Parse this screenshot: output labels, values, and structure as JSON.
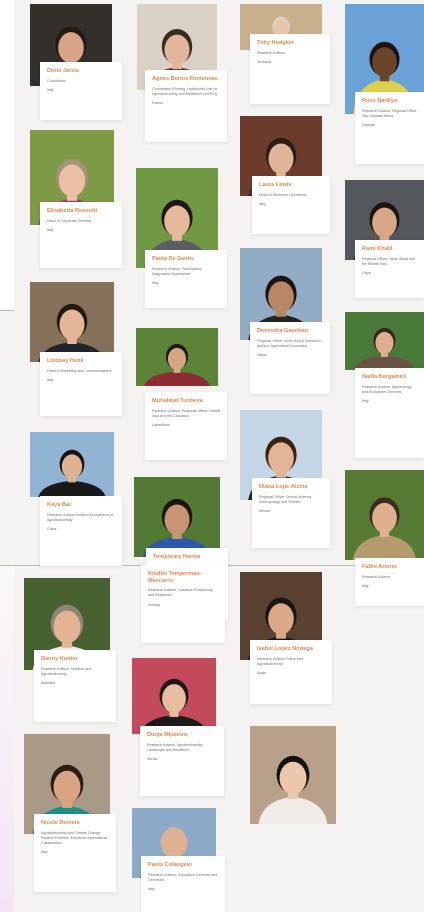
{
  "people": [
    {
      "id": "doris-jarvis",
      "name": "Doris Jarvis",
      "role": "Coordinator",
      "country": "Italy",
      "photo": {
        "bg": "#33302c",
        "skin": "#d8a486",
        "hair": "#241a14",
        "shirt": "#3c3834"
      }
    },
    {
      "id": "agnes-bernis",
      "name": "Agnes Bernis Fonteneau",
      "role": "Coordinator (Poverty, Livelihoods Unit for Agrobiodiversity and Resilience (AGRD))",
      "country": "France",
      "photo": {
        "bg": "#d9d1c5",
        "skin": "#e2b69a",
        "hair": "#3a2a1f",
        "shirt": "#7e2426"
      }
    },
    {
      "id": "toby-hodgkin",
      "name": "Toby Hodgkin",
      "role": "Research Advisor",
      "country": "Scotland",
      "photo": {
        "bg": "#c9b08a",
        "skin": "#e8c6ac",
        "hair": "#d9d2c7",
        "shirt": "#aab3c0"
      }
    },
    {
      "id": "ross-nankya",
      "name": "Ross Nankya",
      "role": "Research Advisor, Regional Office Sub-Saharan Africa",
      "country": "Uganda",
      "photo": {
        "bg": "#6aa2d8",
        "skin": "#6b4429",
        "hair": "#1c130e",
        "shirt": "#ddd04a"
      }
    },
    {
      "id": "laura-lewis",
      "name": "Laura Lewis",
      "role": "Head of Research Operations",
      "country": "Italy",
      "photo": {
        "bg": "#6d3b2c",
        "skin": "#e0b497",
        "hair": "#2a1d16",
        "shirt": "#3a3634"
      }
    },
    {
      "id": "elisabetta-rossetti",
      "name": "Elisabetta Rossetti",
      "role": "Head of Corporate Services",
      "country": "Italy",
      "photo": {
        "bg": "#7d9a46",
        "skin": "#ebc0a6",
        "hair": "#a49378",
        "shirt": "#a03c7c"
      }
    },
    {
      "id": "paola-de-santis",
      "name": "Paola De Santis",
      "role": "Research Advisor, Participatory Diagnostics Approaches",
      "country": "Italy",
      "photo": {
        "bg": "#6f9a43",
        "skin": "#e6b99a",
        "hair": "#1e1814",
        "shirt": "#5a5e64"
      }
    },
    {
      "id": "rami-khalil",
      "name": "Rami Khalil",
      "role": "Regional Officer, Near/ Africa and the Middle East",
      "country": "Libya",
      "photo": {
        "bg": "#54585d",
        "skin": "#d6a785",
        "hair": "#1c1612",
        "shirt": "#3a3c40"
      }
    },
    {
      "id": "devendra-gauchan",
      "name": "Devendra Gauchan",
      "role": "Regional Officer South Asia & Research Advisor, Agricultural Economics",
      "country": "Nepal",
      "photo": {
        "bg": "#93acc6",
        "skin": "#b98764",
        "hair": "#1c1410",
        "shirt": "#262422"
      }
    },
    {
      "id": "nadia-bergamini",
      "name": "Nadia Bergamini",
      "role": "Research Advisor, Agroecology and Ecosystem Services",
      "country": "Italy",
      "photo": {
        "bg": "#4a7a3a",
        "skin": "#dcae92",
        "hair": "#3c2414",
        "shirt": "#6a5344"
      }
    },
    {
      "id": "lindsay-hook",
      "name": "Lindsay Hook",
      "role": "Head of Marketing and Communications",
      "country": "Italy",
      "photo": {
        "bg": "#85705a",
        "skin": "#e2b696",
        "hair": "#22180f",
        "shirt": "#20252d"
      }
    },
    {
      "id": "muhabbat-turdieva",
      "name": "Muhabbat Turdieva",
      "role": "Research Advisor, Regional Officer Central Asia and the Caucasus",
      "country": "Uzbekistan",
      "photo": {
        "bg": "#5c8436",
        "skin": "#d6a684",
        "hair": "#221812",
        "shirt": "#8e2c36"
      }
    },
    {
      "id": "diana-lope-alzina",
      "name": "Diana Lope-Alzina",
      "role": "Regional Officer Central America, Anthropology and Gender",
      "country": "Mexico",
      "photo": {
        "bg": "#c4d6e6",
        "skin": "#e3b496",
        "hair": "#3a2212",
        "shirt": "#1c2834"
      }
    },
    {
      "id": "kaya-bai",
      "name": "Kaya Bai",
      "role": "Research Advisor Nutrient Ecosystems of Agrobiodiversity",
      "country": "China",
      "photo": {
        "bg": "#8fb4d4",
        "skin": "#e0b294",
        "hair": "#19120c",
        "shirt": "#181818"
      }
    },
    {
      "id": "fabio-attorre",
      "name": "Fabio Attorre",
      "role": "Research Advisor",
      "country": "Italy",
      "photo": {
        "bg": "#577a34",
        "skin": "#deb08e",
        "hair": "#3b2c1f",
        "shirt": "#b49a6c"
      }
    },
    {
      "id": "danny-hunter",
      "name": "Danny Hunter",
      "role": "Research Advisor, Nutrition and Agrobiodiversity",
      "country": "Australia",
      "photo": {
        "bg": "#466030",
        "skin": "#e2b494",
        "hair": "#8e8476",
        "shirt": "#efefef"
      }
    },
    {
      "id": "alejandro-temporary",
      "name": "Temporary Hanna",
      "role": "Research Advisor, Linked to Production Functions",
      "country": "Germany",
      "photo": {
        "bg": "#527a34",
        "skin": "#c79474",
        "hair": "#1c1410",
        "shirt": "#2c5aa8"
      }
    },
    {
      "id": "kindlin-temperman",
      "name": "Kindlin Temperman-Meccarro",
      "role": "Research Advisor, Livestock Productivity and Resilience",
      "country": "Norway",
      "photo": null
    },
    {
      "id": "isabel-lopez-noriega",
      "name": "Isabel Lopez Noriega",
      "role": "Research Advisor Policy and Agrobiodiversity",
      "country": "Spain",
      "photo": {
        "bg": "#5a4030",
        "skin": "#d9a988",
        "hair": "#1c1410",
        "shirt": "#1a1a1a"
      }
    },
    {
      "id": "dunja-mijatovic",
      "name": "Dunja Mijatovic",
      "role": "Research Advisor, Agrobiodiversity, Landscape and Resilience",
      "country": "Serbia",
      "photo": {
        "bg": "#c24a5a",
        "skin": "#e8bc9e",
        "hair": "#1e1814",
        "shirt": "#1c1c1c"
      }
    },
    {
      "id": "nicole-demers",
      "name": "Nicole Demers",
      "role": "Agrobiodiversity and Climate Change; Relation Partners, Electronic International Collaboration",
      "country": "Italy",
      "photo": {
        "bg": "#a89a86",
        "skin": "#d8a482",
        "hair": "#2c1c12",
        "shirt": "#1c8e86"
      }
    },
    {
      "id": "paolo-colangelo",
      "name": "Paolo Colangelo",
      "role": "Research Advisor, Population Genetics and Genomics",
      "country": "Italy",
      "photo": {
        "bg": "#8aaac8",
        "skin": "#e0b092",
        "hair": "#e0b092",
        "shirt": "#2a2a2a"
      }
    },
    {
      "id": "new-photo",
      "name": "",
      "role": "",
      "country": "",
      "photo": {
        "bg": "#b8a18a",
        "skin": "#ecc7ac",
        "hair": "#16110e",
        "shirt": "#f2ecea"
      }
    }
  ]
}
